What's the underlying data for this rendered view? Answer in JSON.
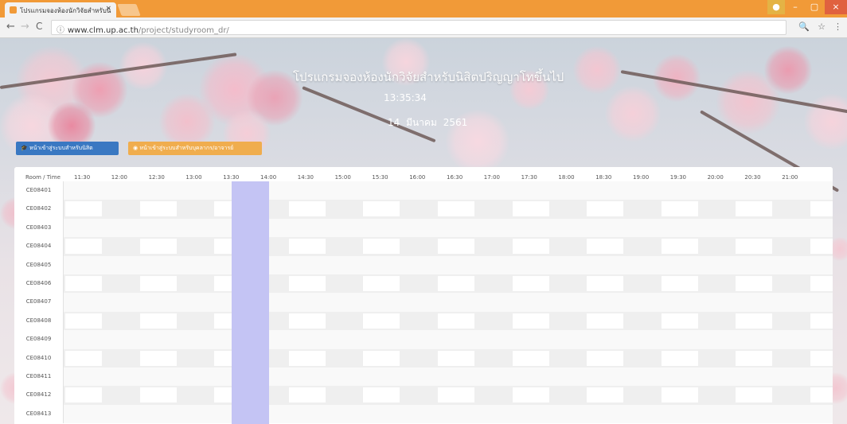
{
  "browser": {
    "tab_title": "โปรแกรมจองห้องนักวิจัยสำหรับนิ",
    "tab_close": "×",
    "url_domain": "www.clm.up.ac.th",
    "url_path": "/project/studyroom_dr/",
    "back": "←",
    "forward": "→",
    "reload": "C",
    "info": "ⓘ",
    "zoom": "🔍",
    "star": "☆",
    "menu": "⋮",
    "win_min": "–",
    "win_max": "▢",
    "win_close": "×"
  },
  "hero": {
    "title": "โปรแกรมจองห้องนักวิจัยสำหรับนิสิตปริญญาโทขึ้นไป",
    "time": "13:35:34",
    "date": "14 มีนาคม 2561",
    "student_button": "หน้าเข้าสู่ระบบสำหรับนิสิต",
    "staff_button": "หน้าเข้าสู่ระบบสำหรับบุคลากร/อาจารย์"
  },
  "grid": {
    "corner_label": "Room / Time",
    "times": [
      "11:30",
      "12:00",
      "12:30",
      "13:00",
      "13:30",
      "14:00",
      "14:30",
      "15:00",
      "15:30",
      "16:00",
      "16:30",
      "17:00",
      "17:30",
      "18:00",
      "18:30",
      "19:00",
      "19:30",
      "20:00",
      "20:30",
      "21:00"
    ],
    "rooms": [
      "CE08401",
      "CE08402",
      "CE08403",
      "CE08404",
      "CE08405",
      "CE08406",
      "CE08407",
      "CE08408",
      "CE08409",
      "CE08410",
      "CE08411",
      "CE08412",
      "CE08413"
    ],
    "current_time_slot": "13:30"
  },
  "colors": {
    "titlebar": "#f19a38",
    "student_button": "#3a78c2",
    "staff_button": "#f0ad4e",
    "current_slot_highlight": "#c4c4f4"
  }
}
